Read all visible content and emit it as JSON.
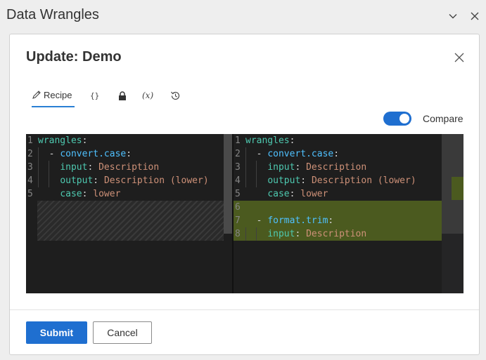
{
  "window": {
    "title": "Data Wrangles",
    "collapse_icon": "chevron-down-icon",
    "close_icon": "close-icon"
  },
  "dialog": {
    "title": "Update: Demo",
    "close_icon": "close-icon"
  },
  "tabs": [
    {
      "label": "Recipe",
      "icon": "pencil-icon",
      "active": true
    },
    {
      "label": "",
      "icon": "braces-icon",
      "active": false
    },
    {
      "label": "",
      "icon": "lock-icon",
      "active": false
    },
    {
      "label": "",
      "icon": "variable-icon",
      "active": false
    },
    {
      "label": "",
      "icon": "history-icon",
      "active": false
    }
  ],
  "icon_glyphs": {
    "braces": "{}",
    "variable": "(x)"
  },
  "compare": {
    "label": "Compare",
    "enabled": true
  },
  "editor": {
    "left": [
      {
        "num": "1",
        "key": "wrangles",
        "punct": ":"
      },
      {
        "num": "2",
        "dash": "- ",
        "sub": "convert.case",
        "punct": ":"
      },
      {
        "num": "3",
        "key": "input",
        "punct": ": ",
        "value": "Description"
      },
      {
        "num": "4",
        "key": "output",
        "punct": ": ",
        "value": "Description (lower)"
      },
      {
        "num": "5",
        "key": "case",
        "punct": ": ",
        "value": "lower"
      }
    ],
    "right": [
      {
        "num": "1",
        "key": "wrangles",
        "punct": ":"
      },
      {
        "num": "2",
        "dash": "- ",
        "sub": "convert.case",
        "punct": ":"
      },
      {
        "num": "3",
        "key": "input",
        "punct": ": ",
        "value": "Description"
      },
      {
        "num": "4",
        "key": "output",
        "punct": ": ",
        "value": "Description (lower)"
      },
      {
        "num": "5",
        "key": "case",
        "punct": ": ",
        "value": "lower"
      },
      {
        "num": "6"
      },
      {
        "num": "7",
        "dash": "- ",
        "sub": "format.trim",
        "punct": ":"
      },
      {
        "num": "8",
        "key": "input",
        "punct": ": ",
        "value": "Description"
      }
    ]
  },
  "footer": {
    "submit_label": "Submit",
    "cancel_label": "Cancel"
  },
  "colors": {
    "accent": "#1f6fd0",
    "added_line": "#4b5a1f",
    "editor_bg": "#1e1e1e"
  }
}
